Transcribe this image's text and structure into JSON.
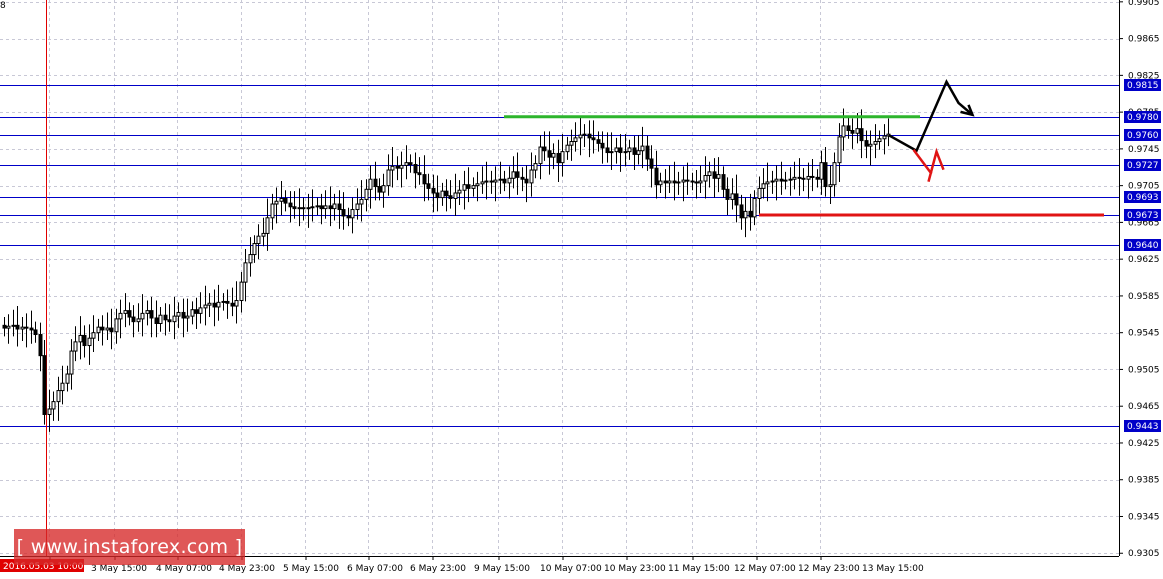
{
  "corner_label": "8",
  "watermark": "[ www.instaforex.com ]",
  "colors": {
    "level_line": "#0000c8",
    "level_badge": "#0000c8",
    "grid": "#c8c8d6",
    "vertical_marker": "#e00000",
    "resistance": "#2db52d",
    "support": "#e01414",
    "bull_path": "#000000",
    "bear_path": "#e01414"
  },
  "chart_data": {
    "type": "candlestick",
    "title": "",
    "xlabel": "",
    "ylabel": "",
    "ylim": [
      0.9302,
      0.9907
    ],
    "y_ticks": [
      "0.9905",
      "0.9865",
      "0.9825",
      "0.9785",
      "0.9745",
      "0.9705",
      "0.9665",
      "0.9625",
      "0.9585",
      "0.9545",
      "0.9505",
      "0.9465",
      "0.9425",
      "0.9385",
      "0.9345",
      "0.9305"
    ],
    "x_ticks": [
      "2016.05.03 10:00",
      "3 May 15:00",
      "4 May 07:00",
      "4 May 23:00",
      "5 May 15:00",
      "6 May 07:00",
      "6 May 23:00",
      "9 May 15:00",
      "10 May 07:00",
      "10 May 23:00",
      "11 May 15:00",
      "12 May 07:00",
      "12 May 23:00",
      "13 May 15:00"
    ],
    "levels": [
      {
        "label": "0.9815",
        "value": 0.9815
      },
      {
        "label": "0.9780",
        "value": 0.978
      },
      {
        "label": "0.9760",
        "value": 0.976
      },
      {
        "label": "0.9727",
        "value": 0.9727
      },
      {
        "label": "0.9693",
        "value": 0.9693
      },
      {
        "label": "0.9673",
        "value": 0.9673
      },
      {
        "label": "0.9640",
        "value": 0.964
      },
      {
        "label": "0.9443",
        "value": 0.9443
      }
    ],
    "marked_time": "2016.05.03 10:00",
    "resistance_line": {
      "value": 0.978,
      "from": "10 May 07:00",
      "to": "13 May 15:00"
    },
    "support_line": {
      "value": 0.9673,
      "from": "12 May 07:00",
      "to": "end"
    },
    "close_series": [
      0.955,
      0.9552,
      0.9553,
      0.9549,
      0.9551,
      0.955,
      0.9548,
      0.9543,
      0.952,
      0.9456,
      0.9462,
      0.947,
      0.9482,
      0.949,
      0.95,
      0.9525,
      0.9535,
      0.9542,
      0.9531,
      0.9539,
      0.9545,
      0.9551,
      0.9548,
      0.955,
      0.9546,
      0.956,
      0.9566,
      0.9569,
      0.9562,
      0.9557,
      0.956,
      0.9566,
      0.9569,
      0.9561,
      0.9555,
      0.9564,
      0.9559,
      0.9557,
      0.9563,
      0.9567,
      0.9561,
      0.9563,
      0.957,
      0.9566,
      0.9572,
      0.9575,
      0.9577,
      0.9573,
      0.9578,
      0.9579,
      0.9577,
      0.9574,
      0.958,
      0.96,
      0.9621,
      0.963,
      0.9642,
      0.965,
      0.9653,
      0.967,
      0.9685,
      0.9688,
      0.9691,
      0.9686,
      0.9682,
      0.968,
      0.9681,
      0.968,
      0.9681,
      0.9682,
      0.9683,
      0.968,
      0.9683,
      0.968,
      0.9685,
      0.9679,
      0.9672,
      0.967,
      0.9679,
      0.9685,
      0.969,
      0.9701,
      0.9712,
      0.9704,
      0.9698,
      0.9705,
      0.9722,
      0.9726,
      0.9724,
      0.9727,
      0.973,
      0.9728,
      0.9719,
      0.9717,
      0.9707,
      0.9702,
      0.9697,
      0.9692,
      0.9699,
      0.9694,
      0.9691,
      0.9697,
      0.97,
      0.9706,
      0.9702,
      0.9705,
      0.9707,
      0.9709,
      0.971,
      0.9709,
      0.9711,
      0.9712,
      0.9708,
      0.9713,
      0.972,
      0.9714,
      0.9712,
      0.9708,
      0.9722,
      0.9729,
      0.9747,
      0.9743,
      0.9736,
      0.974,
      0.973,
      0.9742,
      0.9749,
      0.9753,
      0.9757,
      0.976,
      0.9761,
      0.9757,
      0.9755,
      0.9751,
      0.9746,
      0.9741,
      0.9742,
      0.9746,
      0.9741,
      0.9742,
      0.9746,
      0.9739,
      0.9743,
      0.9748,
      0.9734,
      0.9724,
      0.9706,
      0.971,
      0.9708,
      0.971,
      0.9708,
      0.9709,
      0.9711,
      0.971,
      0.9709,
      0.9708,
      0.971,
      0.9716,
      0.972,
      0.9713,
      0.9717,
      0.9701,
      0.969,
      0.9696,
      0.9684,
      0.967,
      0.9677,
      0.9671,
      0.9691,
      0.9702,
      0.9707,
      0.9709,
      0.971,
      0.9712,
      0.971,
      0.9711,
      0.9712,
      0.9714,
      0.9713,
      0.9712,
      0.9715,
      0.9714,
      0.9712,
      0.973,
      0.9704,
      0.9706,
      0.973,
      0.9758,
      0.977,
      0.9765,
      0.9762,
      0.9767,
      0.9754,
      0.9748,
      0.975,
      0.9753,
      0.9756,
      0.9759,
      0.9761
    ],
    "forecast_paths": [
      {
        "name": "",
        "color_key": "bull_path",
        "points": [
          [
            0.976,
            0
          ],
          [
            0.9743,
            28
          ],
          [
            0.9818,
            58
          ],
          [
            0.9795,
            70
          ],
          [
            0.9782,
            84
          ]
        ]
      },
      {
        "name": "",
        "color_key": "bear_path",
        "points": [
          [
            0.9744,
            0
          ],
          [
            0.9718,
            18
          ]
        ]
      }
    ]
  }
}
